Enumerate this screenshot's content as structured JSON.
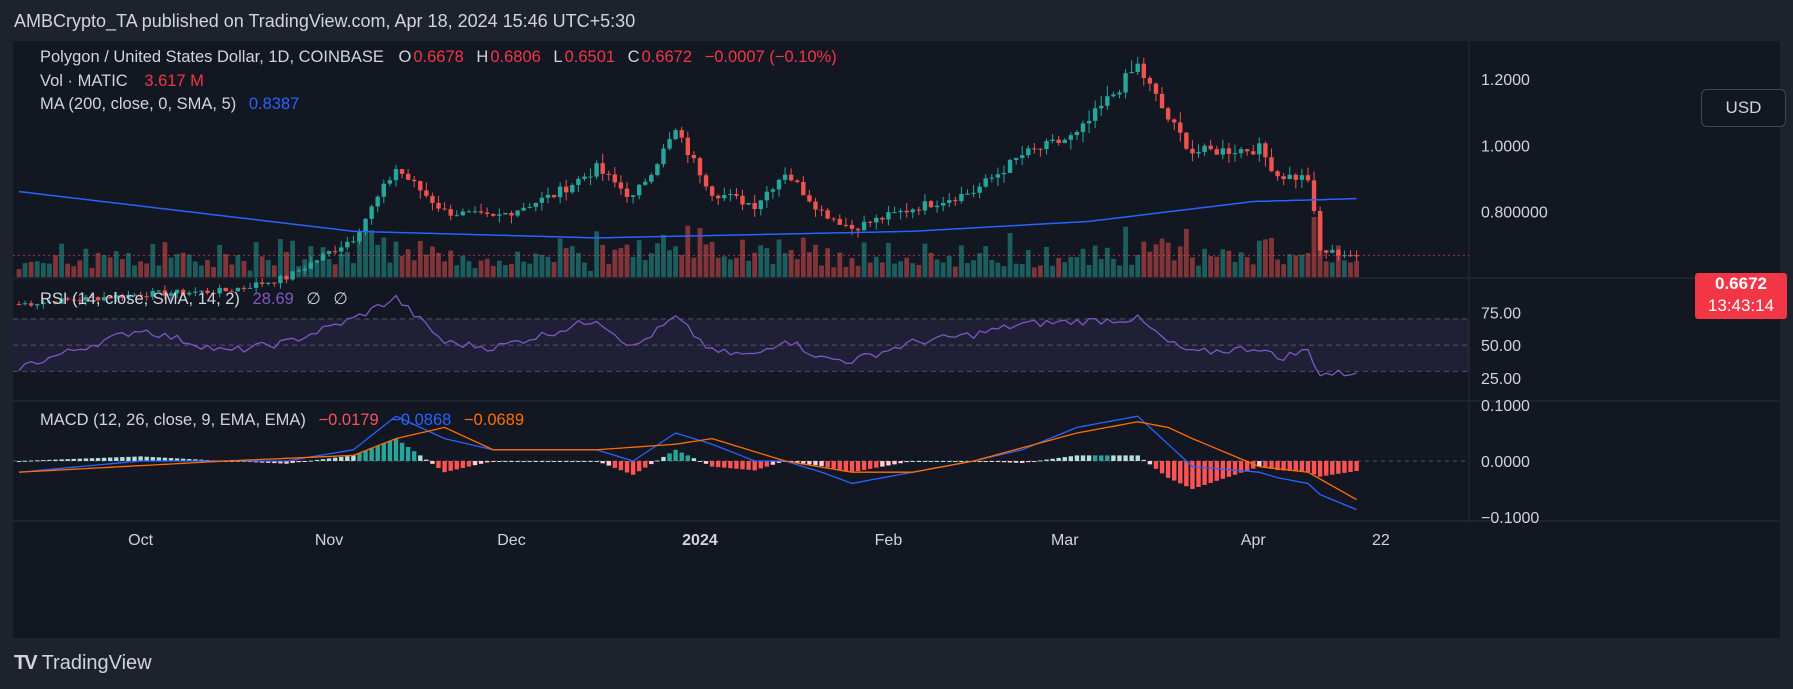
{
  "header": "AMBCrypto_TA published on TradingView.com, Apr 18, 2024 15:46 UTC+5:30",
  "legend": {
    "symbol": "Polygon / United States Dollar, 1D, COINBASE",
    "o_label": "O",
    "o": "0.6678",
    "h_label": "H",
    "h": "0.6806",
    "l_label": "L",
    "l": "0.6501",
    "c_label": "C",
    "c": "0.6672",
    "change": "−0.0007 (−0.10%)",
    "vol_label": "Vol · MATIC",
    "vol": "3.617 M",
    "ma_label": "MA (200, close, 0, SMA, 5)",
    "ma": "0.8387",
    "rsi_label": "RSI (14, close, SMA, 14, 2)",
    "rsi": "28.69",
    "rsi_na1": "∅",
    "rsi_na2": "∅",
    "macd_label": "MACD (12, 26, close, 9, EMA, EMA)",
    "macd_hist": "−0.0179",
    "macd": "−0.0868",
    "macd_signal": "−0.0689"
  },
  "currency_button": "USD",
  "last_price": "0.6672",
  "countdown": "13:43:14",
  "brand": "TradingView",
  "colors": {
    "up": "#26a69a",
    "down": "#ef5350",
    "ma": "#2962ff",
    "rsi": "#7e57c2",
    "macd": "#2962ff",
    "signal": "#ff6d00",
    "background": "#131722"
  },
  "chart_data": [
    {
      "type": "candlestick",
      "title": "Polygon / United States Dollar, 1D, COINBASE",
      "price_axis_ticks": [
        "1.2000",
        "1.0000",
        "0.800000"
      ],
      "ylim": [
        0.62,
        1.3
      ],
      "time_axis_ticks": [
        "Oct",
        "Nov",
        "Dec",
        "2024",
        "Feb",
        "Mar",
        "Apr",
        "22"
      ],
      "date_range": [
        "2023-09-11",
        "2024-04-18"
      ],
      "close_anchors": [
        [
          "2023-09-11",
          0.52
        ],
        [
          "2023-10-01",
          0.55
        ],
        [
          "2023-10-15",
          0.56
        ],
        [
          "2023-10-25",
          0.6
        ],
        [
          "2023-11-05",
          0.72
        ],
        [
          "2023-11-12",
          0.93
        ],
        [
          "2023-11-20",
          0.8
        ],
        [
          "2023-11-28",
          0.78
        ],
        [
          "2023-12-08",
          0.85
        ],
        [
          "2023-12-15",
          0.93
        ],
        [
          "2023-12-21",
          0.84
        ],
        [
          "2023-12-28",
          1.04
        ],
        [
          "2024-01-03",
          0.86
        ],
        [
          "2024-01-10",
          0.82
        ],
        [
          "2024-01-15",
          0.92
        ],
        [
          "2024-01-21",
          0.8
        ],
        [
          "2024-01-26",
          0.75
        ],
        [
          "2024-02-05",
          0.81
        ],
        [
          "2024-02-15",
          0.86
        ],
        [
          "2024-02-23",
          0.97
        ],
        [
          "2024-03-03",
          1.03
        ],
        [
          "2024-03-13",
          1.24
        ],
        [
          "2024-03-18",
          1.08
        ],
        [
          "2024-03-22",
          0.98
        ],
        [
          "2024-04-02",
          0.99
        ],
        [
          "2024-04-05",
          0.91
        ],
        [
          "2024-04-10",
          0.9
        ],
        [
          "2024-04-12",
          0.68
        ],
        [
          "2024-04-18",
          0.6672
        ]
      ],
      "volume_last": "3.617 M",
      "ma200_anchors": [
        [
          "2023-09-11",
          0.86
        ],
        [
          "2023-11-05",
          0.74
        ],
        [
          "2023-12-15",
          0.72
        ],
        [
          "2024-01-10",
          0.73
        ],
        [
          "2024-02-05",
          0.74
        ],
        [
          "2024-03-05",
          0.77
        ],
        [
          "2024-04-01",
          0.83
        ],
        [
          "2024-04-18",
          0.8387
        ]
      ]
    },
    {
      "type": "line",
      "title": "RSI (14, close, SMA, 14, 2)",
      "y_ticks": [
        "75.00",
        "50.00",
        "25.00"
      ],
      "ylim": [
        15,
        95
      ],
      "bands": [
        30,
        50,
        70
      ],
      "last": 28.69,
      "anchors": [
        [
          "2023-09-11",
          33
        ],
        [
          "2023-10-01",
          62
        ],
        [
          "2023-10-15",
          45
        ],
        [
          "2023-10-25",
          52
        ],
        [
          "2023-11-05",
          70
        ],
        [
          "2023-11-12",
          86
        ],
        [
          "2023-11-20",
          52
        ],
        [
          "2023-11-28",
          48
        ],
        [
          "2023-12-08",
          60
        ],
        [
          "2023-12-15",
          70
        ],
        [
          "2023-12-21",
          48
        ],
        [
          "2023-12-28",
          71
        ],
        [
          "2024-01-03",
          45
        ],
        [
          "2024-01-10",
          42
        ],
        [
          "2024-01-15",
          55
        ],
        [
          "2024-01-21",
          40
        ],
        [
          "2024-01-26",
          38
        ],
        [
          "2024-02-05",
          52
        ],
        [
          "2024-02-15",
          58
        ],
        [
          "2024-02-23",
          66
        ],
        [
          "2024-03-03",
          68
        ],
        [
          "2024-03-13",
          70
        ],
        [
          "2024-03-18",
          52
        ],
        [
          "2024-03-22",
          44
        ],
        [
          "2024-04-02",
          48
        ],
        [
          "2024-04-05",
          40
        ],
        [
          "2024-04-10",
          46
        ],
        [
          "2024-04-12",
          28
        ],
        [
          "2024-04-18",
          28.69
        ]
      ]
    },
    {
      "type": "line",
      "title": "MACD (12, 26, close, 9, EMA, EMA)",
      "y_ticks": [
        "0.1000",
        "0.0000",
        "−0.1000"
      ],
      "ylim": [
        -0.11,
        0.11
      ],
      "last": {
        "histogram": -0.0179,
        "macd": -0.0868,
        "signal": -0.0689
      },
      "macd_anchors": [
        [
          "2023-09-11",
          -0.02
        ],
        [
          "2023-10-01",
          0.0
        ],
        [
          "2023-10-15",
          0.0
        ],
        [
          "2023-10-25",
          0.0
        ],
        [
          "2023-11-05",
          0.02
        ],
        [
          "2023-11-12",
          0.08
        ],
        [
          "2023-11-20",
          0.04
        ],
        [
          "2023-11-28",
          0.02
        ],
        [
          "2023-12-08",
          0.02
        ],
        [
          "2023-12-15",
          0.02
        ],
        [
          "2023-12-21",
          0.0
        ],
        [
          "2023-12-28",
          0.05
        ],
        [
          "2024-01-03",
          0.03
        ],
        [
          "2024-01-10",
          0.0
        ],
        [
          "2024-01-15",
          0.0
        ],
        [
          "2024-01-21",
          -0.02
        ],
        [
          "2024-01-26",
          -0.04
        ],
        [
          "2024-02-05",
          -0.02
        ],
        [
          "2024-02-15",
          0.0
        ],
        [
          "2024-02-23",
          0.02
        ],
        [
          "2024-03-03",
          0.06
        ],
        [
          "2024-03-13",
          0.08
        ],
        [
          "2024-03-18",
          0.03
        ],
        [
          "2024-03-22",
          -0.01
        ],
        [
          "2024-04-02",
          -0.02
        ],
        [
          "2024-04-05",
          -0.03
        ],
        [
          "2024-04-10",
          -0.04
        ],
        [
          "2024-04-12",
          -0.06
        ],
        [
          "2024-04-18",
          -0.0868
        ]
      ],
      "signal_anchors": [
        [
          "2023-09-11",
          -0.02
        ],
        [
          "2023-10-15",
          0.0
        ],
        [
          "2023-11-05",
          0.01
        ],
        [
          "2023-11-12",
          0.04
        ],
        [
          "2023-11-20",
          0.06
        ],
        [
          "2023-11-28",
          0.02
        ],
        [
          "2023-12-15",
          0.02
        ],
        [
          "2023-12-28",
          0.03
        ],
        [
          "2024-01-03",
          0.04
        ],
        [
          "2024-01-15",
          0.0
        ],
        [
          "2024-01-26",
          -0.02
        ],
        [
          "2024-02-05",
          -0.02
        ],
        [
          "2024-02-15",
          0.0
        ],
        [
          "2024-03-03",
          0.05
        ],
        [
          "2024-03-13",
          0.07
        ],
        [
          "2024-03-18",
          0.06
        ],
        [
          "2024-03-22",
          0.04
        ],
        [
          "2024-04-02",
          -0.01
        ],
        [
          "2024-04-10",
          -0.02
        ],
        [
          "2024-04-18",
          -0.0689
        ]
      ]
    }
  ]
}
